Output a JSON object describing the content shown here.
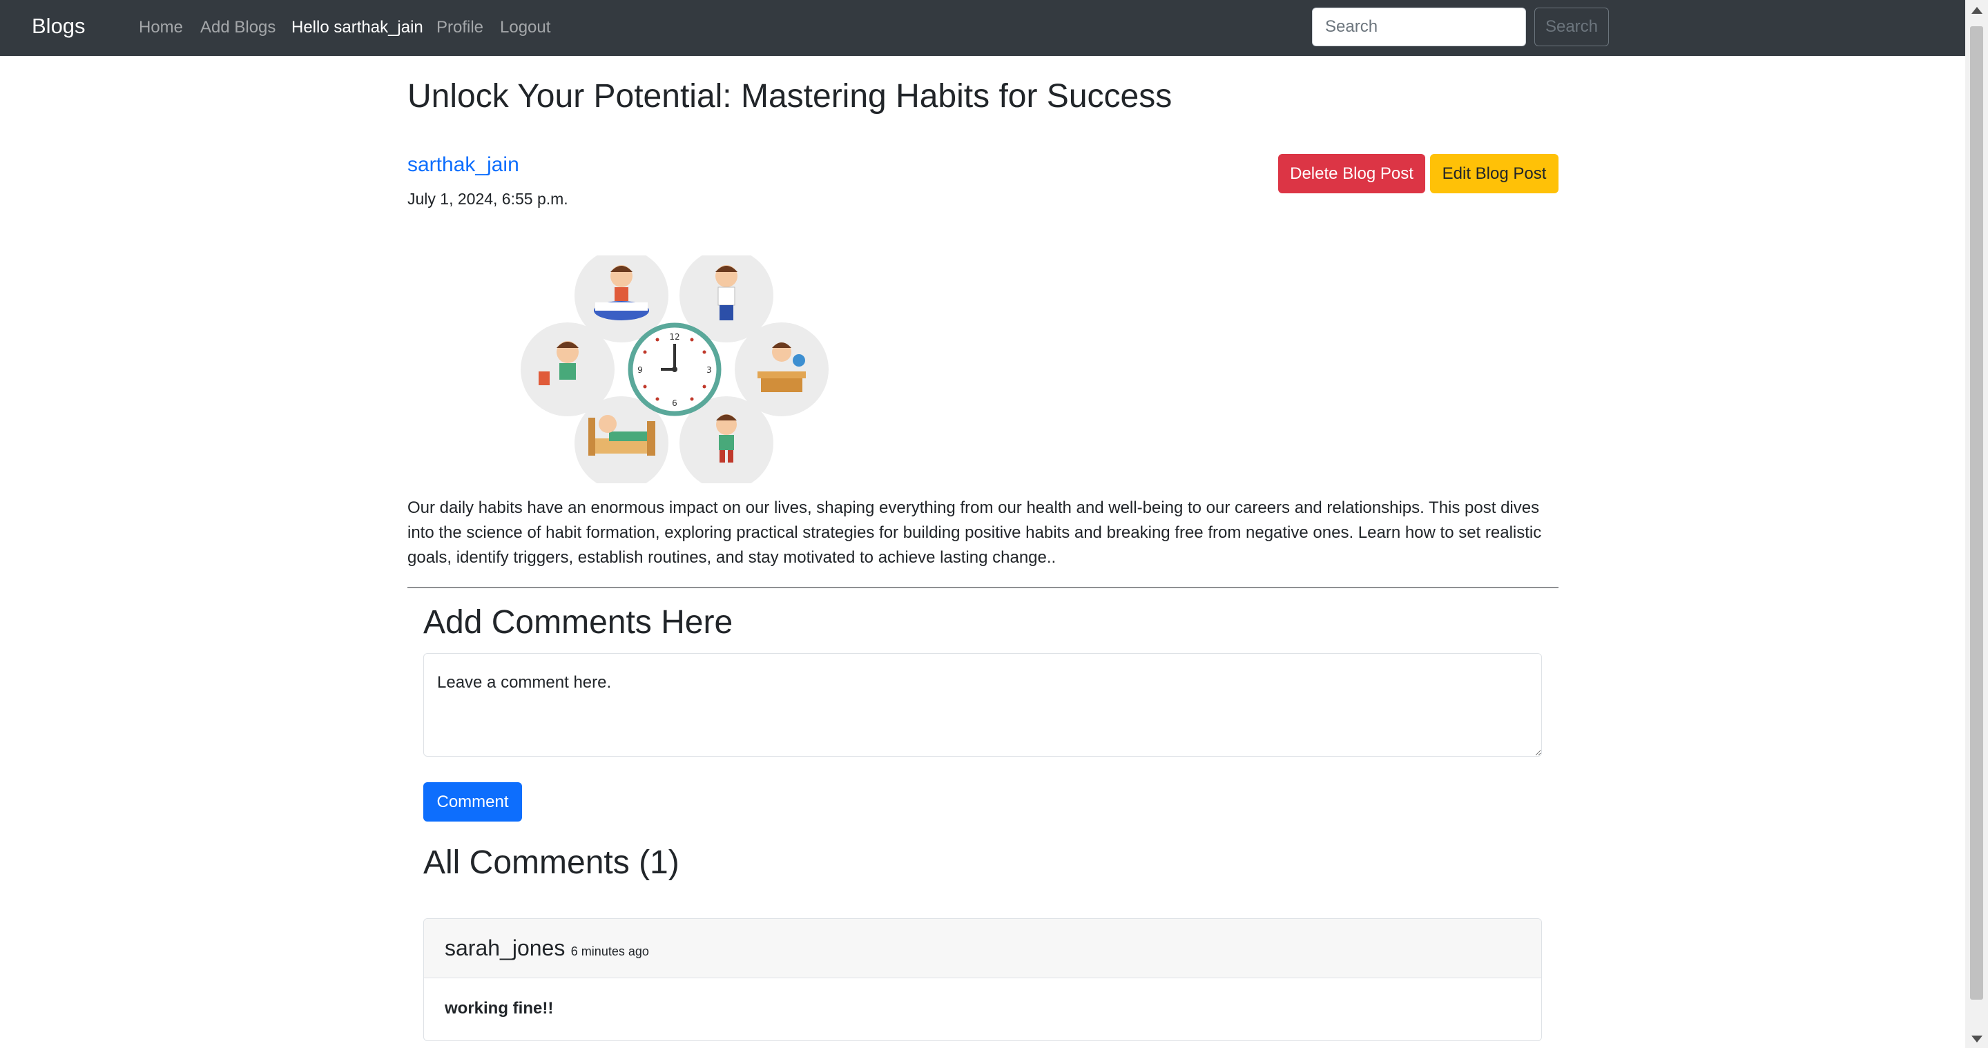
{
  "navbar": {
    "brand": "Blogs",
    "links": [
      {
        "label": "Home"
      },
      {
        "label": "Add Blogs"
      },
      {
        "label": "Hello sarthak_jain"
      },
      {
        "label": "Profile"
      },
      {
        "label": "Logout"
      }
    ],
    "search_placeholder": "Search",
    "search_button": "Search"
  },
  "post": {
    "title": "Unlock Your Potential: Mastering Habits for Success",
    "author": "sarthak_jain",
    "date": "July 1, 2024, 6:55 p.m.",
    "delete_label": "Delete Blog Post",
    "edit_label": "Edit Blog Post",
    "body": "Our daily habits have an enormous impact on our lives, shaping everything from our health and well-being to our careers and relationships. This post dives into the science of habit formation, exploring practical strategies for building positive habits and breaking free from negative ones. Learn how to set realistic goals, identify triggers, establish routines, and stay motivated to achieve lasting change.."
  },
  "comments": {
    "add_heading": "Add Comments Here",
    "placeholder": "Leave a comment here.",
    "submit_label": "Comment",
    "all_heading": "All Comments (1)",
    "items": [
      {
        "user": "sarah_jones",
        "time": "6 minutes ago",
        "text": "working fine!!"
      }
    ]
  },
  "colors": {
    "navbar_bg": "#343a40",
    "primary": "#0d6efd",
    "danger": "#dc3545",
    "warning": "#ffc107"
  }
}
